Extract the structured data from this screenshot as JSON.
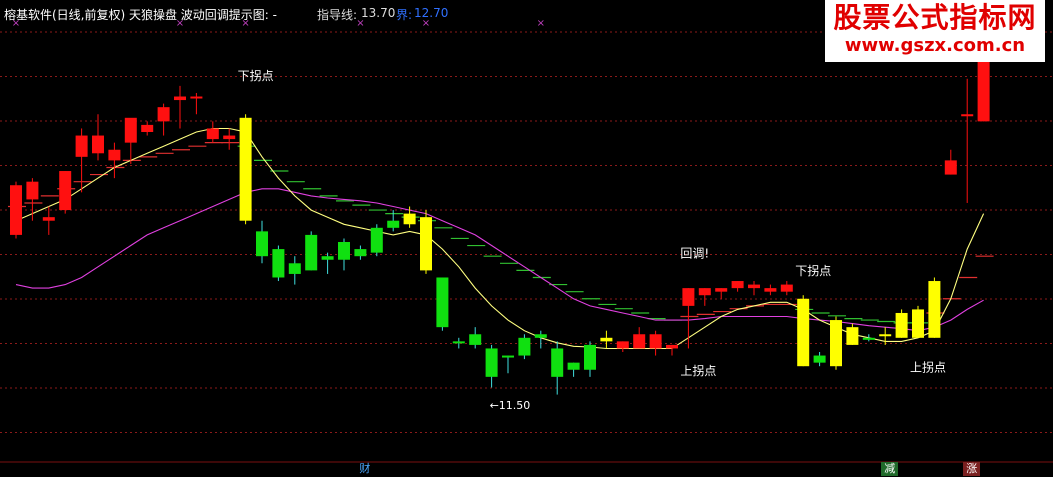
{
  "header": {
    "title": "榕基软件(日线,前复权) 天狼操盘 波动回调提示图: -",
    "guide_label": "指导线:",
    "guide_value": "13.70",
    "jie_label": "界:",
    "jie_value": "12.70"
  },
  "watermark": {
    "line1": "股票公式指标网",
    "line2": "www.gszx.com.cn"
  },
  "colors": {
    "up": "#ff1010",
    "down": "#10e010",
    "warn": "#ffff00",
    "short_ma": "#ffff80",
    "long_ma": "#e040e0",
    "grid": "#8b1a1a",
    "ladder_red": "#e03030",
    "ladder_green": "#30c030",
    "text": "#ffffff"
  },
  "chart_data": {
    "type": "candlestick",
    "ylim": [
      10.7,
      16.9
    ],
    "low_marker": "←11.50",
    "candles": [
      {
        "o": 14.6,
        "h": 14.65,
        "c": 13.9,
        "l": 13.85,
        "color": "up"
      },
      {
        "o": 14.4,
        "h": 14.7,
        "c": 14.65,
        "l": 14.1,
        "color": "up"
      },
      {
        "o": 14.1,
        "h": 14.3,
        "c": 14.15,
        "l": 13.9,
        "color": "up"
      },
      {
        "o": 14.25,
        "h": 14.8,
        "c": 14.8,
        "l": 14.2,
        "color": "up"
      },
      {
        "o": 15.0,
        "h": 15.4,
        "c": 15.3,
        "l": 14.5,
        "color": "up"
      },
      {
        "o": 15.05,
        "h": 15.6,
        "c": 15.3,
        "l": 14.95,
        "color": "up"
      },
      {
        "o": 14.95,
        "h": 15.2,
        "c": 15.1,
        "l": 14.7,
        "color": "up"
      },
      {
        "o": 15.2,
        "h": 15.3,
        "c": 15.55,
        "l": 14.9,
        "color": "up"
      },
      {
        "o": 15.35,
        "h": 15.5,
        "c": 15.45,
        "l": 15.3,
        "color": "up"
      },
      {
        "o": 15.5,
        "h": 15.75,
        "c": 15.7,
        "l": 15.3,
        "color": "up"
      },
      {
        "o": 15.85,
        "h": 16.0,
        "c": 15.8,
        "l": 15.4,
        "color": "up"
      },
      {
        "o": 15.85,
        "h": 15.9,
        "c": 15.85,
        "l": 15.6,
        "color": "up"
      },
      {
        "o": 15.4,
        "h": 15.5,
        "c": 15.25,
        "l": 15.2,
        "color": "up"
      },
      {
        "o": 15.3,
        "h": 15.4,
        "c": 15.25,
        "l": 15.1,
        "color": "up"
      },
      {
        "o": 15.55,
        "h": 15.6,
        "c": 14.1,
        "l": 14.05,
        "color": "warn"
      },
      {
        "o": 13.95,
        "h": 14.1,
        "c": 13.6,
        "l": 13.5,
        "color": "down"
      },
      {
        "o": 13.7,
        "h": 13.75,
        "c": 13.3,
        "l": 13.25,
        "color": "down"
      },
      {
        "o": 13.5,
        "h": 13.6,
        "c": 13.35,
        "l": 13.2,
        "color": "down"
      },
      {
        "o": 13.9,
        "h": 13.95,
        "c": 13.4,
        "l": 13.4,
        "color": "down"
      },
      {
        "o": 13.6,
        "h": 13.65,
        "c": 13.55,
        "l": 13.35,
        "color": "down"
      },
      {
        "o": 13.8,
        "h": 13.85,
        "c": 13.55,
        "l": 13.4,
        "color": "down"
      },
      {
        "o": 13.7,
        "h": 13.75,
        "c": 13.6,
        "l": 13.55,
        "color": "down"
      },
      {
        "o": 14.0,
        "h": 14.05,
        "c": 13.65,
        "l": 13.6,
        "color": "down"
      },
      {
        "o": 14.1,
        "h": 14.25,
        "c": 14.0,
        "l": 13.95,
        "color": "down"
      },
      {
        "o": 14.2,
        "h": 14.3,
        "c": 14.05,
        "l": 14.0,
        "color": "warn"
      },
      {
        "o": 14.15,
        "h": 14.25,
        "c": 13.4,
        "l": 13.35,
        "color": "warn"
      },
      {
        "o": 13.3,
        "h": 13.3,
        "c": 12.6,
        "l": 12.55,
        "color": "down"
      },
      {
        "o": 12.4,
        "h": 12.45,
        "c": 12.4,
        "l": 12.3,
        "color": "down"
      },
      {
        "o": 12.5,
        "h": 12.6,
        "c": 12.35,
        "l": 12.3,
        "color": "down"
      },
      {
        "o": 12.3,
        "h": 12.35,
        "c": 11.9,
        "l": 11.75,
        "color": "down"
      },
      {
        "o": 12.2,
        "h": 12.2,
        "c": 12.2,
        "l": 11.95,
        "color": "down"
      },
      {
        "o": 12.45,
        "h": 12.5,
        "c": 12.2,
        "l": 12.15,
        "color": "down"
      },
      {
        "o": 12.5,
        "h": 12.55,
        "c": 12.45,
        "l": 12.3,
        "color": "down"
      },
      {
        "o": 12.3,
        "h": 12.4,
        "c": 11.9,
        "l": 11.65,
        "color": "down"
      },
      {
        "o": 12.1,
        "h": 12.1,
        "c": 12.0,
        "l": 11.9,
        "color": "down"
      },
      {
        "o": 12.35,
        "h": 12.4,
        "c": 12.0,
        "l": 11.9,
        "color": "down"
      },
      {
        "o": 12.45,
        "h": 12.55,
        "c": 12.4,
        "l": 12.3,
        "color": "warn"
      },
      {
        "o": 12.3,
        "h": 12.4,
        "c": 12.4,
        "l": 12.25,
        "color": "up"
      },
      {
        "o": 12.5,
        "h": 12.6,
        "c": 12.3,
        "l": 12.3,
        "color": "up"
      },
      {
        "o": 12.5,
        "h": 12.55,
        "c": 12.3,
        "l": 12.2,
        "color": "up"
      },
      {
        "o": 12.3,
        "h": 12.35,
        "c": 12.35,
        "l": 12.2,
        "color": "up"
      },
      {
        "o": 12.9,
        "h": 13.15,
        "c": 13.15,
        "l": 12.3,
        "color": "up"
      },
      {
        "o": 13.05,
        "h": 13.15,
        "c": 13.15,
        "l": 12.9,
        "color": "up"
      },
      {
        "o": 13.1,
        "h": 13.15,
        "c": 13.15,
        "l": 13.0,
        "color": "up"
      },
      {
        "o": 13.15,
        "h": 13.25,
        "c": 13.25,
        "l": 13.1,
        "color": "up"
      },
      {
        "o": 13.2,
        "h": 13.25,
        "c": 13.15,
        "l": 13.05,
        "color": "up"
      },
      {
        "o": 13.15,
        "h": 13.2,
        "c": 13.1,
        "l": 13.05,
        "color": "up"
      },
      {
        "o": 13.1,
        "h": 13.25,
        "c": 13.2,
        "l": 13.05,
        "color": "up"
      },
      {
        "o": 13.0,
        "h": 13.05,
        "c": 12.05,
        "l": 12.05,
        "color": "warn"
      },
      {
        "o": 12.2,
        "h": 12.25,
        "c": 12.1,
        "l": 12.05,
        "color": "down"
      },
      {
        "o": 12.7,
        "h": 12.75,
        "c": 12.05,
        "l": 12.0,
        "color": "warn"
      },
      {
        "o": 12.6,
        "h": 12.65,
        "c": 12.35,
        "l": 12.35,
        "color": "warn"
      },
      {
        "o": 12.45,
        "h": 12.5,
        "c": 12.45,
        "l": 12.4,
        "color": "down"
      },
      {
        "o": 12.5,
        "h": 12.6,
        "c": 12.5,
        "l": 12.35,
        "color": "warn"
      },
      {
        "o": 12.8,
        "h": 12.85,
        "c": 12.45,
        "l": 12.45,
        "color": "warn"
      },
      {
        "o": 12.85,
        "h": 12.9,
        "c": 12.45,
        "l": 12.45,
        "color": "warn"
      },
      {
        "o": 13.25,
        "h": 13.3,
        "c": 12.45,
        "l": 12.45,
        "color": "warn"
      },
      {
        "o": 14.95,
        "h": 15.1,
        "c": 14.75,
        "l": 14.75,
        "color": "up"
      },
      {
        "o": 15.6,
        "h": 16.1,
        "c": 15.6,
        "l": 14.35,
        "color": "up"
      },
      {
        "o": 16.9,
        "h": 16.9,
        "c": 15.5,
        "l": 15.5,
        "color": "up"
      }
    ],
    "ma_short": [
      14.1,
      14.2,
      14.3,
      14.4,
      14.55,
      14.7,
      14.85,
      14.95,
      15.05,
      15.15,
      15.25,
      15.35,
      15.4,
      15.4,
      15.35,
      15.0,
      14.7,
      14.45,
      14.25,
      14.15,
      14.05,
      14.0,
      13.95,
      13.9,
      13.95,
      13.9,
      13.7,
      13.45,
      13.15,
      12.9,
      12.7,
      12.55,
      12.45,
      12.38,
      12.33,
      12.32,
      12.3,
      12.3,
      12.3,
      12.3,
      12.3,
      12.45,
      12.6,
      12.75,
      12.85,
      12.9,
      12.95,
      12.95,
      12.85,
      12.7,
      12.6,
      12.5,
      12.45,
      12.4,
      12.4,
      12.45,
      12.55,
      13.0,
      13.7,
      14.2
    ],
    "ma_long": [
      13.2,
      13.15,
      13.15,
      13.2,
      13.3,
      13.45,
      13.6,
      13.75,
      13.9,
      14.0,
      14.1,
      14.2,
      14.3,
      14.4,
      14.5,
      14.55,
      14.55,
      14.5,
      14.45,
      14.42,
      14.4,
      14.38,
      14.35,
      14.3,
      14.25,
      14.2,
      14.1,
      14.0,
      13.9,
      13.75,
      13.6,
      13.45,
      13.3,
      13.15,
      13.0,
      12.9,
      12.85,
      12.8,
      12.75,
      12.7,
      12.7,
      12.7,
      12.72,
      12.75,
      12.75,
      12.75,
      12.75,
      12.75,
      12.72,
      12.7,
      12.68,
      12.65,
      12.62,
      12.6,
      12.58,
      12.55,
      12.6,
      12.7,
      12.85,
      12.98
    ],
    "ladder": [
      {
        "y": 14.3,
        "c": "ladder_red"
      },
      {
        "y": 14.35,
        "c": "ladder_red"
      },
      {
        "y": 14.45,
        "c": "ladder_red"
      },
      {
        "y": 14.55,
        "c": "ladder_red"
      },
      {
        "y": 14.65,
        "c": "ladder_red"
      },
      {
        "y": 14.75,
        "c": "ladder_red"
      },
      {
        "y": 14.85,
        "c": "ladder_red"
      },
      {
        "y": 14.95,
        "c": "ladder_red"
      },
      {
        "y": 15.0,
        "c": "ladder_red"
      },
      {
        "y": 15.05,
        "c": "ladder_red"
      },
      {
        "y": 15.1,
        "c": "ladder_red"
      },
      {
        "y": 15.15,
        "c": "ladder_red"
      },
      {
        "y": 15.2,
        "c": "ladder_red"
      },
      {
        "y": 15.2,
        "c": "ladder_red"
      },
      {
        "y": 15.15,
        "c": "ladder_green"
      },
      {
        "y": 14.95,
        "c": "ladder_green"
      },
      {
        "y": 14.8,
        "c": "ladder_green"
      },
      {
        "y": 14.65,
        "c": "ladder_green"
      },
      {
        "y": 14.55,
        "c": "ladder_green"
      },
      {
        "y": 14.45,
        "c": "ladder_green"
      },
      {
        "y": 14.38,
        "c": "ladder_green"
      },
      {
        "y": 14.32,
        "c": "ladder_green"
      },
      {
        "y": 14.25,
        "c": "ladder_green"
      },
      {
        "y": 14.2,
        "c": "ladder_green"
      },
      {
        "y": 14.15,
        "c": "ladder_green"
      },
      {
        "y": 14.1,
        "c": "ladder_green"
      },
      {
        "y": 14.0,
        "c": "ladder_green"
      },
      {
        "y": 13.85,
        "c": "ladder_green"
      },
      {
        "y": 13.75,
        "c": "ladder_green"
      },
      {
        "y": 13.6,
        "c": "ladder_green"
      },
      {
        "y": 13.5,
        "c": "ladder_green"
      },
      {
        "y": 13.4,
        "c": "ladder_green"
      },
      {
        "y": 13.3,
        "c": "ladder_green"
      },
      {
        "y": 13.2,
        "c": "ladder_green"
      },
      {
        "y": 13.1,
        "c": "ladder_green"
      },
      {
        "y": 13.0,
        "c": "ladder_green"
      },
      {
        "y": 12.92,
        "c": "ladder_green"
      },
      {
        "y": 12.86,
        "c": "ladder_green"
      },
      {
        "y": 12.8,
        "c": "ladder_green"
      },
      {
        "y": 12.72,
        "c": "ladder_green"
      },
      {
        "y": 12.7,
        "c": "ladder_green"
      },
      {
        "y": 12.75,
        "c": "ladder_red"
      },
      {
        "y": 12.78,
        "c": "ladder_red"
      },
      {
        "y": 12.82,
        "c": "ladder_red"
      },
      {
        "y": 12.86,
        "c": "ladder_red"
      },
      {
        "y": 12.9,
        "c": "ladder_red"
      },
      {
        "y": 12.92,
        "c": "ladder_red"
      },
      {
        "y": 12.92,
        "c": "ladder_red"
      },
      {
        "y": 12.85,
        "c": "ladder_green"
      },
      {
        "y": 12.8,
        "c": "ladder_green"
      },
      {
        "y": 12.76,
        "c": "ladder_green"
      },
      {
        "y": 12.72,
        "c": "ladder_green"
      },
      {
        "y": 12.7,
        "c": "ladder_green"
      },
      {
        "y": 12.68,
        "c": "ladder_green"
      },
      {
        "y": 12.66,
        "c": "ladder_green"
      },
      {
        "y": 12.66,
        "c": "ladder_green"
      },
      {
        "y": 12.8,
        "c": "ladder_red"
      },
      {
        "y": 13.0,
        "c": "ladder_red"
      },
      {
        "y": 13.3,
        "c": "ladder_red"
      },
      {
        "y": 13.6,
        "c": "ladder_red"
      }
    ],
    "annotations": [
      {
        "i": 14,
        "y": 16.0,
        "text": "下拐点",
        "anchor": "above"
      },
      {
        "i": 41,
        "y": 13.5,
        "text": "回调!",
        "anchor": "above"
      },
      {
        "i": 48,
        "y": 13.25,
        "text": "下拐点",
        "anchor": "above"
      },
      {
        "i": 41,
        "y": 12.15,
        "text": "上拐点",
        "anchor": "below"
      },
      {
        "i": 55,
        "y": 12.2,
        "text": "上拐点",
        "anchor": "below"
      }
    ],
    "bottom_tags": [
      {
        "i": 21,
        "text": "财",
        "color": "#4aa8ff",
        "bg": ""
      },
      {
        "i": 53,
        "text": "减",
        "color": "#ffffff",
        "bg": "#1f6a2a"
      },
      {
        "i": 58,
        "text": "涨",
        "color": "#ffffff",
        "bg": "#7a2020"
      }
    ],
    "top_markers": [
      0,
      10,
      14,
      21,
      25,
      32
    ]
  }
}
